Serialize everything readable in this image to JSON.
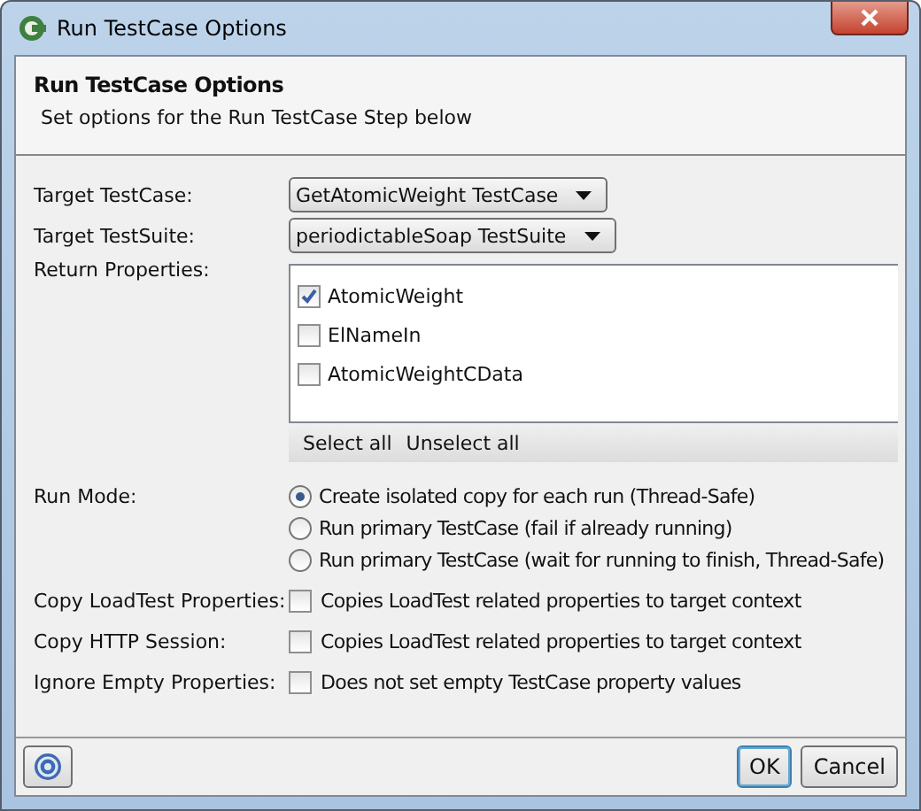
{
  "window": {
    "title": "Run TestCase Options"
  },
  "header": {
    "title": "Run TestCase Options",
    "description": "Set options for the Run TestCase Step below"
  },
  "target_testcase": {
    "label": "Target TestCase:",
    "value": "GetAtomicWeight TestCase"
  },
  "target_testsuite": {
    "label": "Target TestSuite:",
    "value": "periodictableSoap TestSuite"
  },
  "return_properties": {
    "label": "Return Properties:",
    "items": [
      {
        "label": "AtomicWeight",
        "checked": true
      },
      {
        "label": "ElNameIn",
        "checked": false
      },
      {
        "label": "AtomicWeightCData",
        "checked": false
      }
    ],
    "buttons": [
      "Select all",
      "Unselect all"
    ]
  },
  "run_mode": {
    "label": "Run Mode:",
    "options": [
      {
        "label": "Create isolated copy for each run (Thread-Safe)",
        "selected": true
      },
      {
        "label": "Run primary TestCase (fail if already running)",
        "selected": false
      },
      {
        "label": "Run primary TestCase (wait for running to finish, Thread-Safe)",
        "selected": false
      }
    ]
  },
  "options": [
    {
      "label": "Copy LoadTest Properties:",
      "text": "Copies LoadTest related properties to target context",
      "checked": false
    },
    {
      "label": "Copy HTTP Session:",
      "text": "Copies LoadTest related properties to target context",
      "checked": false
    },
    {
      "label": "Ignore Empty Properties:",
      "text": "Does not set empty TestCase property values",
      "checked": false
    }
  ],
  "buttons": [
    "OK",
    "Cancel"
  ]
}
